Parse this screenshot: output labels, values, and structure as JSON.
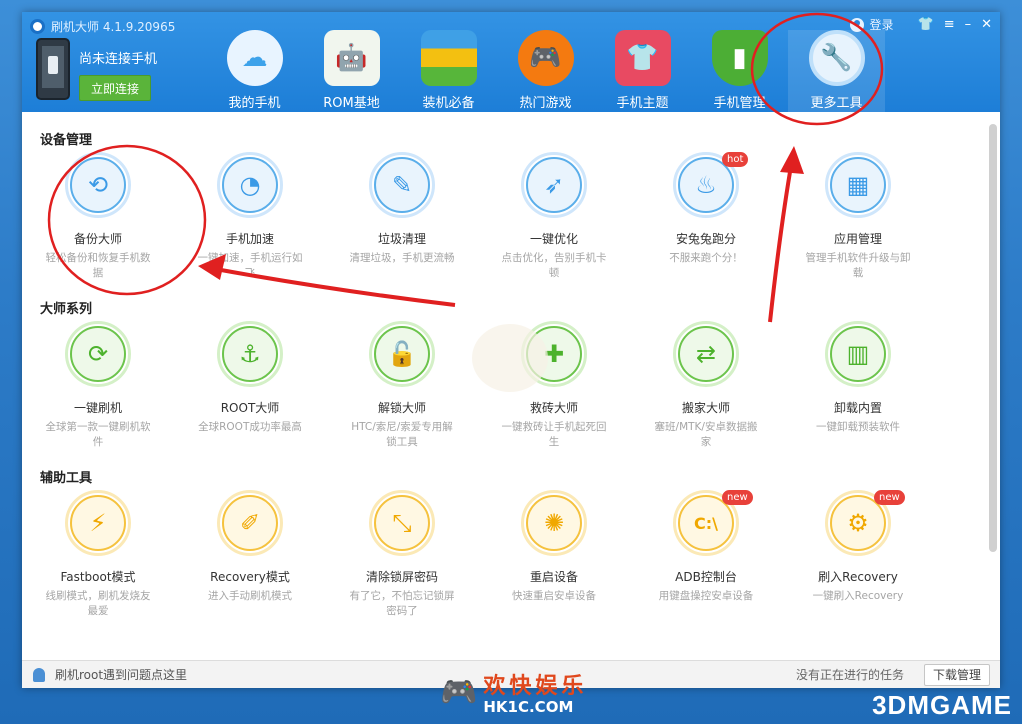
{
  "window": {
    "title": "刷机大师 4.1.9.20965",
    "login": "登录"
  },
  "device": {
    "status": "尚未连接手机",
    "connect_button": "立即连接"
  },
  "nav": [
    {
      "label": "我的手机",
      "icon": "cloud-icon",
      "color": "#3da2ea"
    },
    {
      "label": "ROM基地",
      "icon": "android-bag-icon",
      "color": "#58b845"
    },
    {
      "label": "装机必备",
      "icon": "stack-icon",
      "color": "#f0b400"
    },
    {
      "label": "热门游戏",
      "icon": "gamepad-icon",
      "color": "#f47a10"
    },
    {
      "label": "手机主题",
      "icon": "tshirt-icon",
      "color": "#e84a62"
    },
    {
      "label": "手机管理",
      "icon": "shield-icon",
      "color": "#4cae35"
    },
    {
      "label": "更多工具",
      "icon": "wrench-icon",
      "color": "#3f9de8"
    }
  ],
  "sections": [
    {
      "title": "设备管理",
      "tools": [
        {
          "name": "备份大师",
          "desc": "轻松备份和恢复手机数据",
          "icon": "backup-icon",
          "glyph": "⟲"
        },
        {
          "name": "手机加速",
          "desc": "一键加速，手机运行如飞",
          "icon": "speedometer-icon",
          "glyph": "◔"
        },
        {
          "name": "垃圾清理",
          "desc": "清理垃圾，手机更流畅",
          "icon": "brush-icon",
          "glyph": "✎"
        },
        {
          "name": "一键优化",
          "desc": "点击优化，告别手机卡顿",
          "icon": "rocket-icon",
          "glyph": "➶"
        },
        {
          "name": "安兔兔跑分",
          "desc": "不服来跑个分！",
          "icon": "flame-icon",
          "glyph": "♨",
          "badge": "hot"
        },
        {
          "name": "应用管理",
          "desc": "管理手机软件升级与卸载",
          "icon": "apps-grid-icon",
          "glyph": "▦"
        }
      ]
    },
    {
      "title": "大师系列",
      "tools": [
        {
          "name": "一键刷机",
          "desc": "全球第一款一键刷机软件",
          "icon": "refresh-icon",
          "glyph": "⟳"
        },
        {
          "name": "ROOT大师",
          "desc": "全球ROOT成功率最高",
          "icon": "anchor-icon",
          "glyph": "⚓"
        },
        {
          "name": "解锁大师",
          "desc": "HTC/索尼/索爱专用解锁工具",
          "icon": "unlock-icon",
          "glyph": "🔓"
        },
        {
          "name": "救砖大师",
          "desc": "一键救砖让手机起死回生",
          "icon": "phone-plus-icon",
          "glyph": "✚"
        },
        {
          "name": "搬家大师",
          "desc": "塞班/MTK/安卓数据搬家",
          "icon": "transfer-icon",
          "glyph": "⇄"
        },
        {
          "name": "卸载内置",
          "desc": "一键卸载预装软件",
          "icon": "trash-icon",
          "glyph": "▥"
        }
      ]
    },
    {
      "title": "辅助工具",
      "tools": [
        {
          "name": "Fastboot模式",
          "desc": "线刷模式，刷机发烧友最爱",
          "icon": "lightning-icon",
          "glyph": "⚡"
        },
        {
          "name": "Recovery模式",
          "desc": "进入手动刷机模式",
          "icon": "tablet-edit-icon",
          "glyph": "✐"
        },
        {
          "name": "清除锁屏密码",
          "desc": "有了它，不怕忘记锁屏密码了",
          "icon": "pattern-lock-icon",
          "glyph": "⤡"
        },
        {
          "name": "重启设备",
          "desc": "快速重启安卓设备",
          "icon": "loading-icon",
          "glyph": "✺"
        },
        {
          "name": "ADB控制台",
          "desc": "用键盘操控安卓设备",
          "icon": "console-icon",
          "glyph": "C:\\",
          "badge": "new"
        },
        {
          "name": "刷入Recovery",
          "desc": "一键刷入Recovery",
          "icon": "gear-tablet-icon",
          "glyph": "⚙",
          "badge": "new"
        }
      ]
    }
  ],
  "statusbar": {
    "left": "刷机root遇到问题点这里",
    "right": "没有正在进行的任务",
    "download_button": "下载管理"
  },
  "watermark": {
    "site_cn": "欢快娱乐",
    "site_url": "HK1C.COM",
    "brand": "3DMGAME"
  }
}
